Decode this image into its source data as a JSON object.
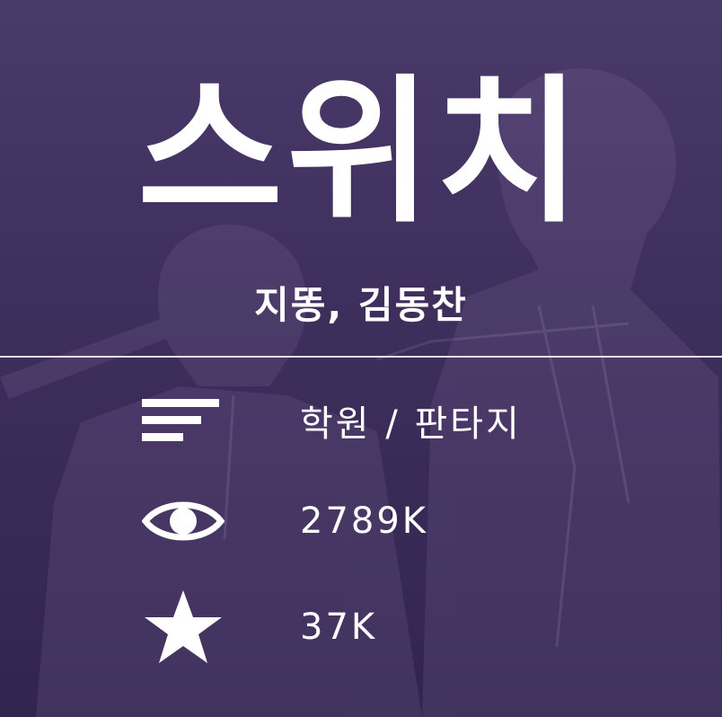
{
  "title": "스위치",
  "authors": "지똥, 김동찬",
  "info": {
    "genre": "학원 / 판타지",
    "views": "2789K",
    "rating": "37K"
  },
  "icons": {
    "genre": "list-icon",
    "views": "eye-icon",
    "rating": "star-icon"
  },
  "colors": {
    "overlay": "#3e2e5c",
    "text": "#ffffff"
  }
}
